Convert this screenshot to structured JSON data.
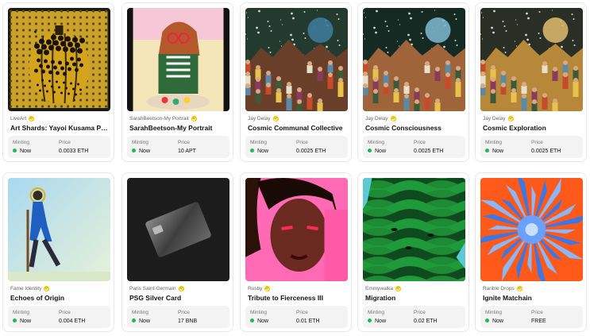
{
  "cards": [
    {
      "creator": "LiveArt",
      "title": "Art Shards: Yayoi Kusama Pu...",
      "status_label": "Minting",
      "status": "Now",
      "price_label": "Price",
      "price": "0.0033 ETH",
      "art": "pumpkin"
    },
    {
      "creator": "SarahBeetson-My Portrait",
      "title": "SarahBeetson-My Portrait",
      "status_label": "Minting",
      "status": "Now",
      "price_label": "Price",
      "price": "10 APT",
      "art": "portrait"
    },
    {
      "creator": "Jay Delay",
      "title": "Cosmic Communal Collective",
      "status_label": "Minting",
      "status": "Now",
      "price_label": "Price",
      "price": "0.0025 ETH",
      "art": "cosmic1"
    },
    {
      "creator": "Jay Delay",
      "title": "Cosmic Consciousness",
      "status_label": "Minting",
      "status": "Now",
      "price_label": "Price",
      "price": "0.0025 ETH",
      "art": "cosmic2"
    },
    {
      "creator": "Jay Delay",
      "title": "Cosmic Exploration",
      "status_label": "Minting",
      "status": "Now",
      "price_label": "Price",
      "price": "0.0025 ETH",
      "art": "cosmic3"
    },
    {
      "creator": "Fame Identity",
      "title": "Echoes of Origin",
      "status_label": "Minting",
      "status": "Now",
      "price_label": "Price",
      "price": "0.004 ETH",
      "art": "walker"
    },
    {
      "creator": "Paris Saint-Germain",
      "title": "PSG Silver Card",
      "status_label": "Minting",
      "status": "Now",
      "price_label": "Price",
      "price": "17 BNB",
      "art": "card"
    },
    {
      "creator": "Rusby",
      "title": "Tribute to Fierceness III",
      "status_label": "Minting",
      "status": "Now",
      "price_label": "Price",
      "price": "0.01 ETH",
      "art": "face"
    },
    {
      "creator": "Emmywalka",
      "title": "Migration",
      "status_label": "Minting",
      "status": "Now",
      "price_label": "Price",
      "price": "0.02 ETH",
      "art": "waves"
    },
    {
      "creator": "Rarible Drops",
      "title": "Ignite Matchain",
      "status_label": "Minting",
      "status": "Now",
      "price_label": "Price",
      "price": "FREE",
      "art": "burst"
    }
  ],
  "colors": {
    "accent_live": "#1db954",
    "verified_badge": "#f2c200",
    "info_bg": "#f3f3f3"
  }
}
